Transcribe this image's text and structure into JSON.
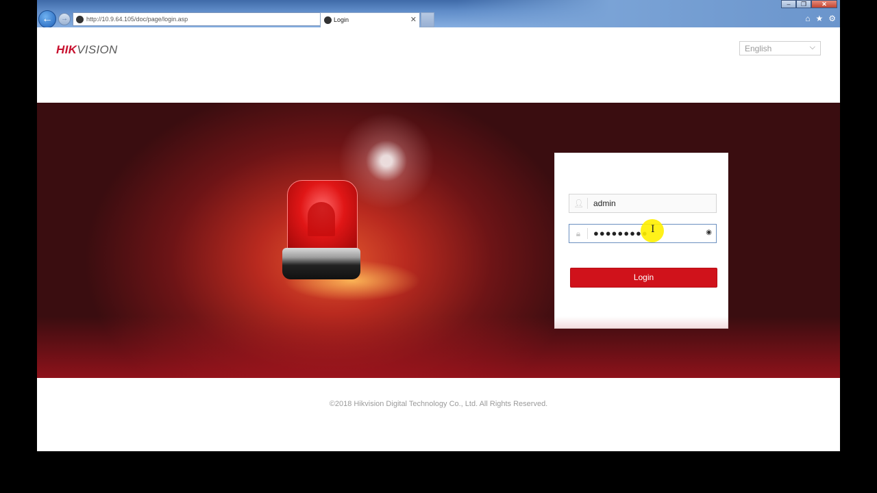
{
  "browser": {
    "url": "http://10.9.64.105/doc/page/login.asp",
    "tab_title": "Login",
    "tab_close": "✕",
    "back_glyph": "←",
    "forward_glyph": "→",
    "addr_tools": [
      "⌕",
      "▾",
      "↻"
    ],
    "window_controls": [
      "–",
      "❐",
      "✕"
    ],
    "tool_icons": [
      "home-icon",
      "star-icon",
      "gear-icon"
    ]
  },
  "header": {
    "logo_primary": "HIK",
    "logo_secondary": "VISION",
    "language": "English"
  },
  "login": {
    "username": "admin",
    "password_mask": "●●●●●●●●●",
    "button_label": "Login"
  },
  "footer": {
    "copyright": "©2018 Hikvision Digital Technology Co., Ltd. All Rights Reserved."
  },
  "colors": {
    "brand_red": "#d0121b",
    "chrome_blue": "#5f8cc8"
  }
}
